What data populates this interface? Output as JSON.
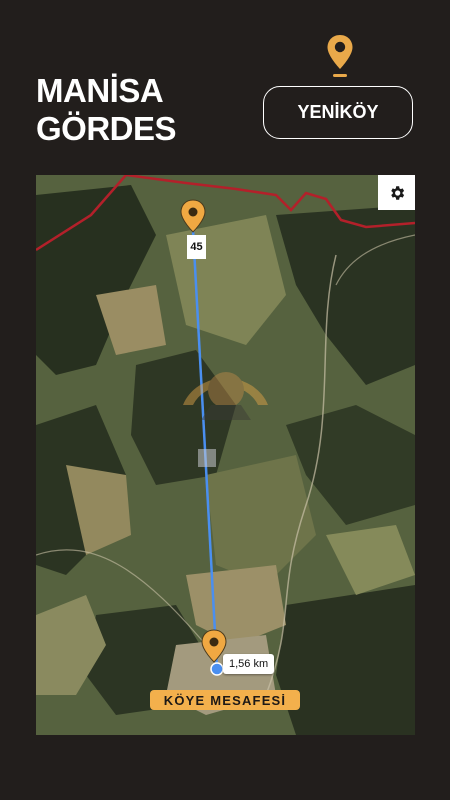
{
  "header": {
    "title_line1": "MANİSA",
    "title_line2": "GÖRDES",
    "location_icon": "map-pin-icon",
    "village_button": "YENİKÖY"
  },
  "map": {
    "settings_icon": "gear-icon",
    "bearing_label": "45",
    "distance_label": "1,56 km",
    "badge_label": "KÖYE MESAFESİ",
    "colors": {
      "background": "#221e1c",
      "accent": "#f3b04c",
      "route_line": "#4a8ff0",
      "boundary_line": "#b3202a"
    }
  }
}
